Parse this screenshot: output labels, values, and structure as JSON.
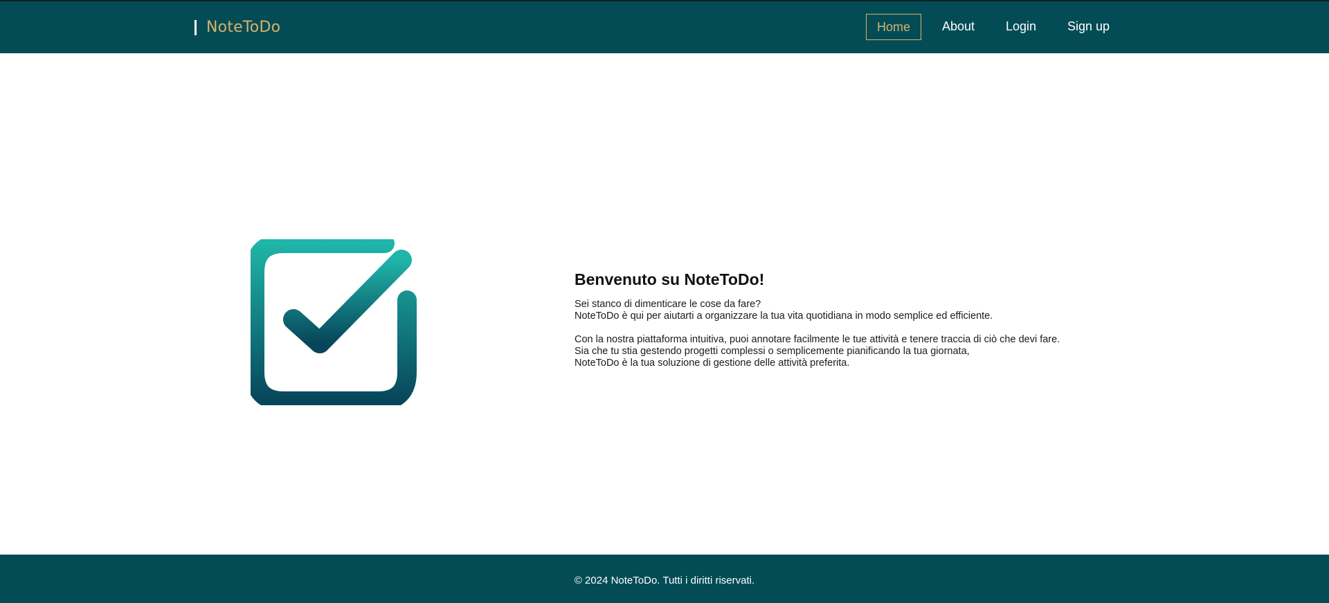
{
  "brand": {
    "name": "NoteToDo"
  },
  "nav": {
    "home": "Home",
    "about": "About",
    "login": "Login",
    "signup": "Sign up"
  },
  "hero": {
    "logo_icon": "checkbox-check-icon",
    "title": "Benvenuto su NoteToDo!",
    "line1": "Sei stanco di dimenticare le cose da fare?",
    "line2": "NoteToDo è qui per aiutarti a organizzare la tua vita quotidiana in modo semplice ed efficiente.",
    "line3": "Con la nostra piattaforma intuitiva, puoi annotare facilmente le tue attività e tenere traccia di ciò che devi fare.",
    "line4": "Sia che tu stia gestendo progetti complessi o semplicemente pianificando la tua giornata,",
    "line5": "NoteToDo è la tua soluzione di gestione delle attività preferita."
  },
  "footer": {
    "text": "© 2024 NoteToDo. Tutti i diritti riservati."
  },
  "colors": {
    "header_bg": "#034c55",
    "accent_gold": "#d8b16a",
    "logo_gradient_top": "#1fb5a8",
    "logo_gradient_bottom": "#07465a"
  }
}
